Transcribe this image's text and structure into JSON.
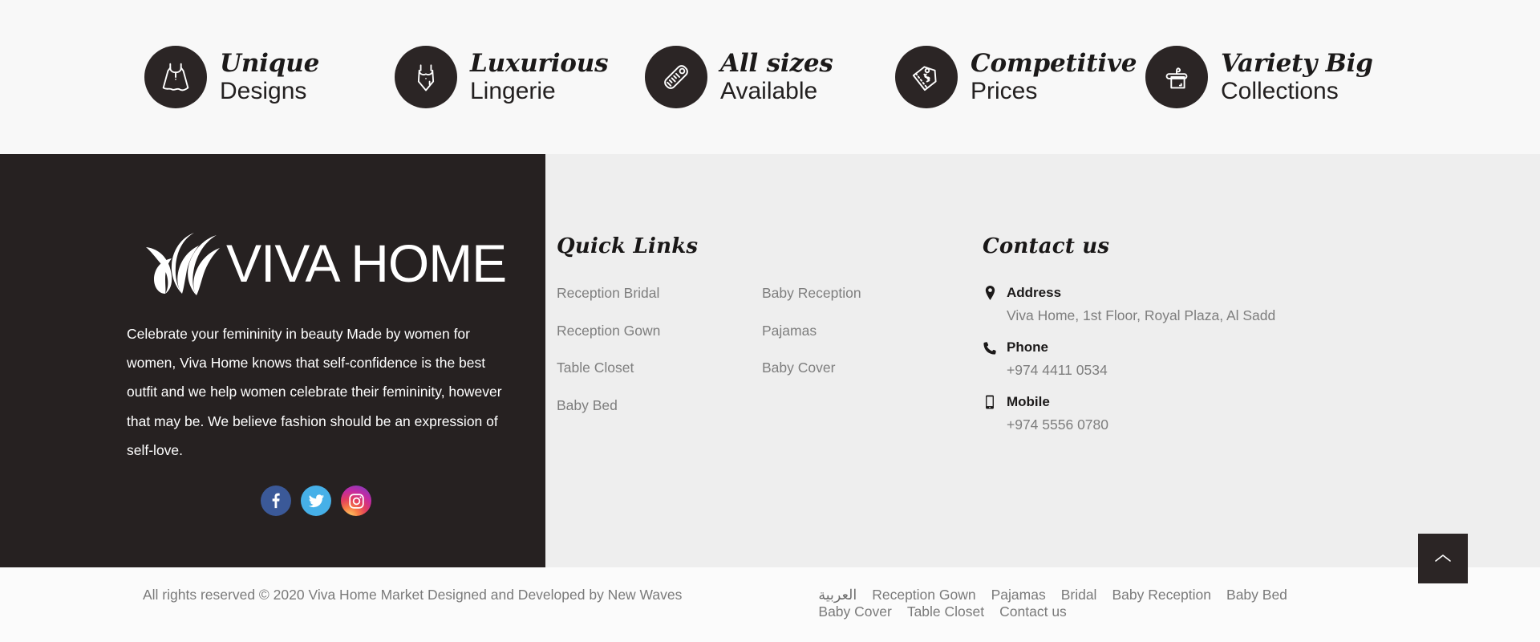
{
  "features": [
    {
      "icon": "dress-icon",
      "title": "Unique",
      "sub": "Designs"
    },
    {
      "icon": "lingerie-icon",
      "title": "Luxurious",
      "sub": "Lingerie"
    },
    {
      "icon": "ruler-icon",
      "title": "All sizes",
      "sub": "Available"
    },
    {
      "icon": "price-tag-icon",
      "title": "Competitive",
      "sub": "Prices"
    },
    {
      "icon": "hanger-icon",
      "title": "Variety Big",
      "sub": "Collections"
    }
  ],
  "footer": {
    "logo_word": "VIVA HOME",
    "description": "Celebrate your femininity in beauty Made by women for women, Viva Home knows that self-confidence is the best outfit and we help women celebrate their femininity, however that may be.\nWe believe fashion should be an expression of self-love.",
    "socials": [
      {
        "name": "facebook",
        "label": "Facebook"
      },
      {
        "name": "twitter",
        "label": "Twitter"
      },
      {
        "name": "instagram",
        "label": "Instagram"
      }
    ],
    "quick_links": {
      "heading": "Quick Links",
      "column_1": [
        "Reception Bridal",
        "Reception Gown",
        "Table Closet",
        "Baby Bed"
      ],
      "column_2": [
        "Baby Reception",
        "Pajamas",
        "Baby Cover"
      ]
    },
    "contact": {
      "heading": "Contact us",
      "items": [
        {
          "icon": "location-pin-icon",
          "label": "Address",
          "value": "Viva Home, 1st Floor, Royal Plaza, Al Sadd"
        },
        {
          "icon": "phone-icon",
          "label": "Phone",
          "value": "+974 4411 0534"
        },
        {
          "icon": "mobile-icon",
          "label": "Mobile",
          "value": "+974 5556 0780"
        }
      ]
    }
  },
  "bottom_bar": {
    "copyright": "All rights reserved © 2020 Viva Home Market Designed and Developed by New Waves",
    "nav": [
      "العربية",
      "Reception Gown",
      "Pajamas",
      "Bridal",
      "Baby Reception",
      "Baby Bed",
      "Baby Cover",
      "Table Closet",
      "Contact us"
    ],
    "scroll_top_icon": "chevron-up-icon"
  },
  "colors": {
    "dark": "#262121",
    "strip_bg": "#f8f8f8",
    "panel_bg": "#eeeeee",
    "muted_text": "#7e7e7e",
    "facebook": "#3b5998",
    "twitter": "#46b0e8"
  }
}
